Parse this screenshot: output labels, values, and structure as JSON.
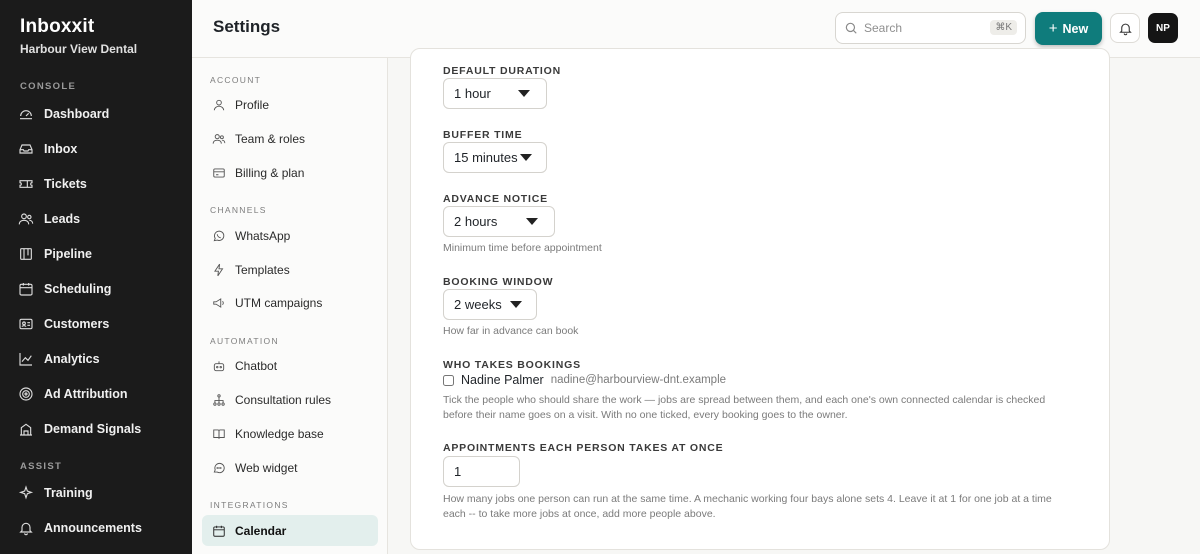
{
  "app": {
    "name": "Inboxxit",
    "org": "Harbour View Dental"
  },
  "sidebar": {
    "sections": [
      {
        "label": "CONSOLE"
      },
      {
        "label": "ASSIST"
      }
    ],
    "items": [
      {
        "label": "Dashboard",
        "icon": "dashboard-icon"
      },
      {
        "label": "Inbox",
        "icon": "inbox-icon"
      },
      {
        "label": "Tickets",
        "icon": "ticket-icon"
      },
      {
        "label": "Leads",
        "icon": "users-icon"
      },
      {
        "label": "Pipeline",
        "icon": "pipeline-icon"
      },
      {
        "label": "Scheduling",
        "icon": "calendar-icon"
      },
      {
        "label": "Customers",
        "icon": "id-card-icon"
      },
      {
        "label": "Analytics",
        "icon": "chart-line-icon"
      },
      {
        "label": "Ad Attribution",
        "icon": "target-icon"
      },
      {
        "label": "Demand Signals",
        "icon": "building-icon"
      },
      {
        "label": "Training",
        "icon": "sparkle-icon"
      },
      {
        "label": "Announcements",
        "icon": "bell-icon"
      }
    ]
  },
  "header": {
    "title": "Settings",
    "search_placeholder": "Search",
    "search_shortcut": "⌘K",
    "new_label": "New",
    "avatar_initials": "NP"
  },
  "subnav": {
    "sections": [
      "ACCOUNT",
      "CHANNELS",
      "AUTOMATION",
      "INTEGRATIONS"
    ],
    "items": [
      {
        "label": "Profile",
        "icon": "user-icon"
      },
      {
        "label": "Team & roles",
        "icon": "team-icon"
      },
      {
        "label": "Billing & plan",
        "icon": "credit-card-icon"
      },
      {
        "label": "WhatsApp",
        "icon": "whatsapp-icon"
      },
      {
        "label": "Templates",
        "icon": "bolt-icon"
      },
      {
        "label": "UTM campaigns",
        "icon": "megaphone-icon"
      },
      {
        "label": "Chatbot",
        "icon": "robot-icon"
      },
      {
        "label": "Consultation rules",
        "icon": "hierarchy-icon"
      },
      {
        "label": "Knowledge base",
        "icon": "book-icon"
      },
      {
        "label": "Web widget",
        "icon": "chat-bubble-icon"
      },
      {
        "label": "Calendar",
        "icon": "calendar-icon"
      }
    ],
    "active": "Calendar"
  },
  "form": {
    "default_duration": {
      "label": "DEFAULT DURATION",
      "value": "1 hour"
    },
    "buffer_time": {
      "label": "BUFFER TIME",
      "value": "15 minutes"
    },
    "advance_notice": {
      "label": "ADVANCE NOTICE",
      "value": "2 hours",
      "hint": "Minimum time before appointment"
    },
    "booking_window": {
      "label": "BOOKING WINDOW",
      "value": "2 weeks",
      "hint": "How far in advance can book"
    },
    "who_takes_bookings": {
      "label": "WHO TAKES BOOKINGS",
      "person_name": "Nadine Palmer",
      "person_email": "nadine@harbourview-dnt.example",
      "checked": false,
      "hint": "Tick the people who should share the work — jobs are spread between them, and each one's own connected calendar is checked before their name goes on a visit. With no one ticked, every booking goes to the owner."
    },
    "capacity": {
      "label": "APPOINTMENTS EACH PERSON TAKES AT ONCE",
      "value": "1",
      "hint": "How many jobs one person can run at the same time. A mechanic working four bays alone sets 4. Leave it at 1 for one job at a time each -- to take more jobs at once, add more people above."
    }
  },
  "colors": {
    "accent": "#0f7c7c",
    "sidebar_bg": "#1b1b1b",
    "active_bg": "#e3efed"
  }
}
